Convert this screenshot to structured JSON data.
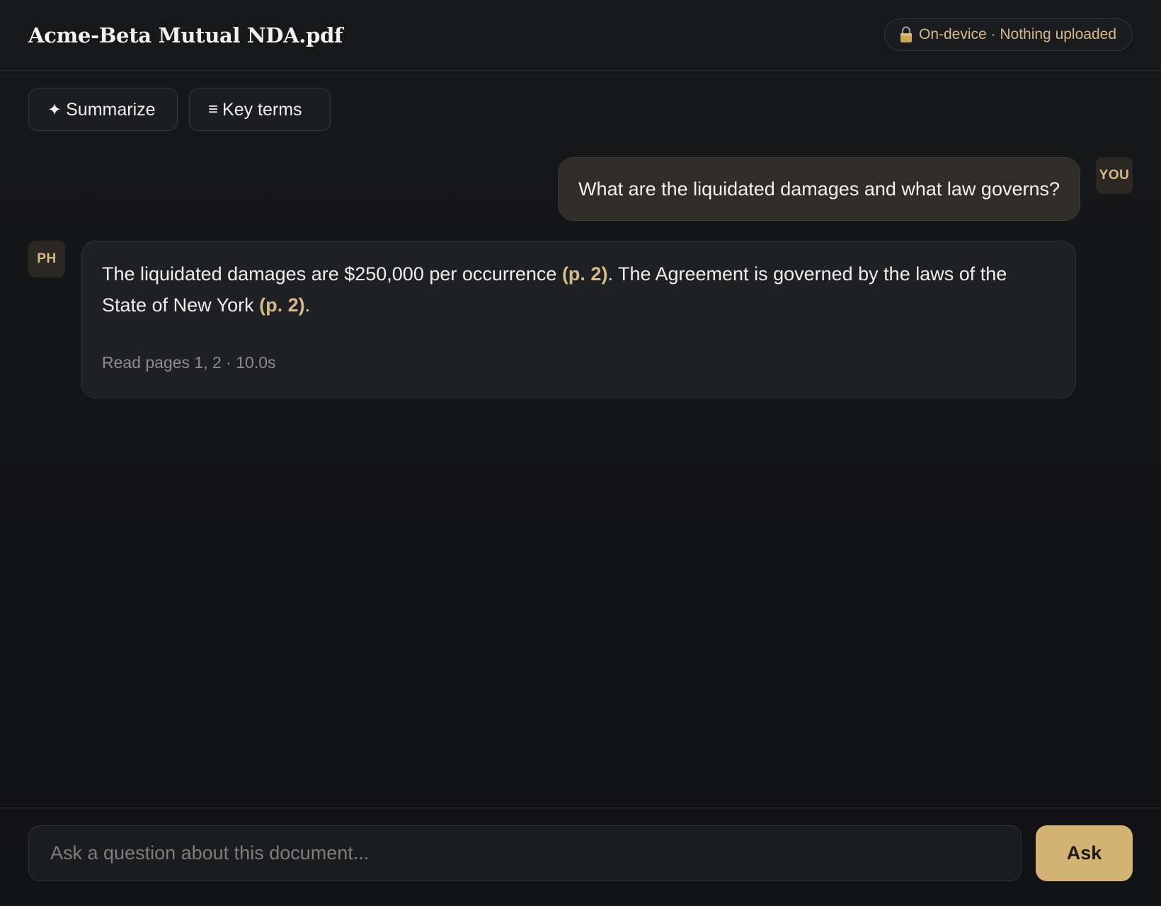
{
  "header": {
    "title": "Acme-Beta Mutual NDA.pdf",
    "privacy_badge": {
      "icon": "lock-icon",
      "text": "On-device · Nothing uploaded"
    }
  },
  "actions": [
    {
      "icon": "sparkle-icon",
      "glyph": "✦",
      "label": "Summarize"
    },
    {
      "icon": "list-icon",
      "glyph": "≡",
      "label": "Key terms"
    }
  ],
  "conversation": {
    "user_message": {
      "avatar": "YOU",
      "text": "What are the liquidated damages and what law governs?"
    },
    "assistant_message": {
      "avatar": "PH",
      "segments": [
        {
          "text": "The liquidated damages are $250,000 per occurrence ",
          "citation": false
        },
        {
          "text": "(p. 2)",
          "citation": true
        },
        {
          "text": ". The Agreement is governed by the laws of the State of New York ",
          "citation": false
        },
        {
          "text": "(p. 2)",
          "citation": true
        },
        {
          "text": ".",
          "citation": false
        }
      ],
      "meta": "Read pages 1, 2 · 10.0s"
    }
  },
  "composer": {
    "placeholder": "Ask a question about this document...",
    "value": "",
    "submit_label": "Ask"
  },
  "colors": {
    "background": "#131416",
    "accent": "#d3b374",
    "citation": "#d6b98a",
    "user_bubble": "#302c27",
    "assistant_bubble": "#1f2023"
  }
}
